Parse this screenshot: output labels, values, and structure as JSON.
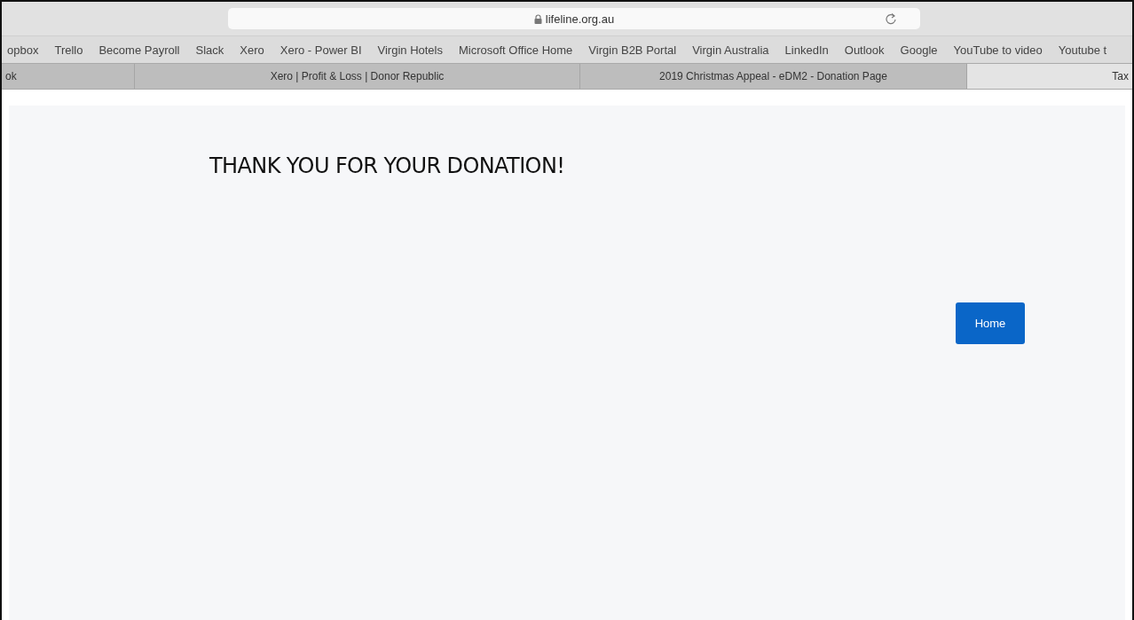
{
  "address_bar": {
    "url": "lifeline.org.au"
  },
  "bookmarks": [
    "opbox",
    "Trello",
    "Become Payroll",
    "Slack",
    "Xero",
    "Xero - Power BI",
    "Virgin Hotels",
    "Microsoft Office Home",
    "Virgin B2B Portal",
    "Virgin Australia",
    "LinkedIn",
    "Outlook",
    "Google",
    "YouTube to video",
    "Youtube t"
  ],
  "tabs": [
    {
      "label": "ok",
      "selected": false
    },
    {
      "label": "Xero | Profit & Loss | Donor Republic",
      "selected": false
    },
    {
      "label": "2019 Christmas Appeal - eDM2 - Donation Page",
      "selected": false
    },
    {
      "label": "Tax",
      "selected": true
    }
  ],
  "page": {
    "heading": "THANK YOU FOR YOUR DONATION!",
    "button": "Home"
  }
}
